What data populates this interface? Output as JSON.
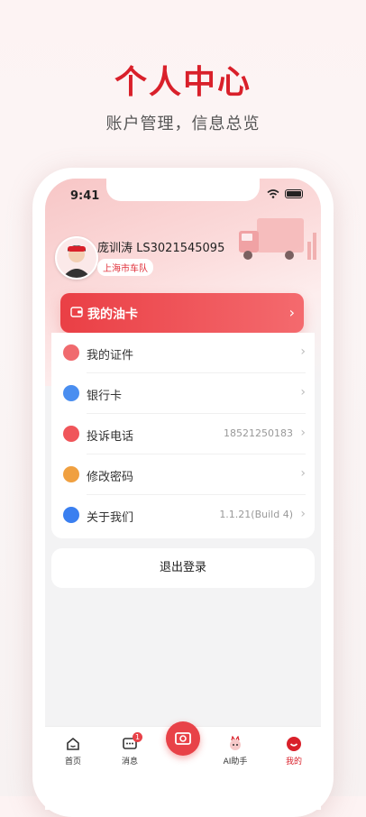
{
  "promo": {
    "title": "个人中心",
    "subtitle": "账户管理，信息总览"
  },
  "status_bar": {
    "time": "9:41"
  },
  "profile": {
    "name": "庞训涛 LS3021545095",
    "team": "上海市车队"
  },
  "oil_card": {
    "label": "我的油卡"
  },
  "menu": [
    {
      "label": "我的证件",
      "value": "",
      "icon": "id-card-icon",
      "color": "#f06a6e"
    },
    {
      "label": "银行卡",
      "value": "",
      "icon": "bank-card-icon",
      "color": "#4a8ef0"
    },
    {
      "label": "投诉电话",
      "value": "18521250183",
      "icon": "phone-icon",
      "color": "#f0555a"
    },
    {
      "label": "修改密码",
      "value": "",
      "icon": "lock-icon",
      "color": "#f0a040"
    },
    {
      "label": "关于我们",
      "value": "1.1.21(Build 4)",
      "icon": "info-icon",
      "color": "#3a7ff0"
    }
  ],
  "logout": {
    "label": "退出登录"
  },
  "tabs": [
    {
      "label": "首页"
    },
    {
      "label": "消息",
      "badge": "1"
    },
    {
      "label": "AI助手"
    },
    {
      "label": "我的"
    }
  ],
  "colors": {
    "accent": "#d9202a",
    "card_gradient_start": "#ea3f45",
    "card_gradient_end": "#f46a6e"
  }
}
